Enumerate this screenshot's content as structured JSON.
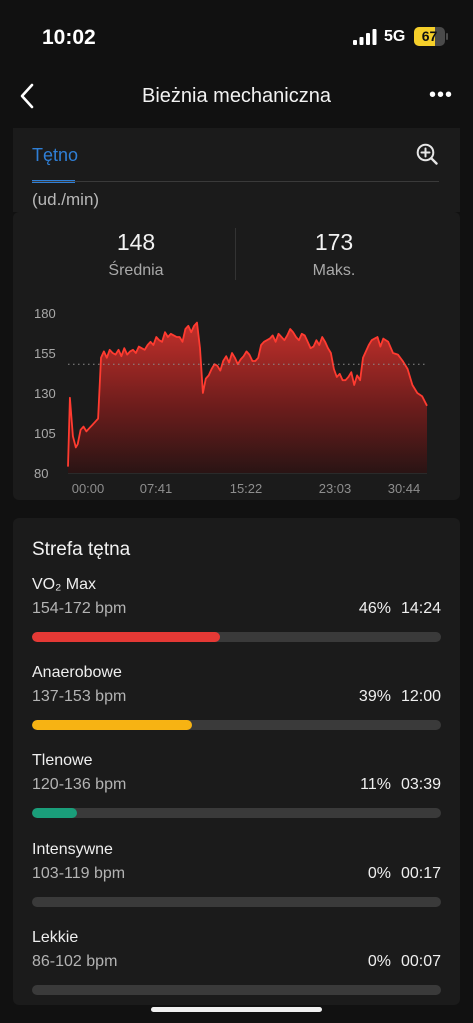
{
  "status_bar": {
    "time": "10:02",
    "network": "5G",
    "battery": "67",
    "battery_level": 0.67
  },
  "nav": {
    "title": "Bieżnia mechaniczna",
    "back_icon": "chevron-left-icon",
    "more_icon": "more-horizontal-icon",
    "more_label": "•••"
  },
  "tab": {
    "label": "Tętno",
    "zoom_icon": "zoom-in-icon",
    "unit": "(ud./min)"
  },
  "stats": {
    "average": {
      "value": "148",
      "label": "Średnia"
    },
    "max": {
      "value": "173",
      "label": "Maks."
    }
  },
  "chart_data": {
    "type": "area",
    "y_ticks": [
      "180",
      "155",
      "130",
      "105",
      "80"
    ],
    "x_ticks": [
      "00:00",
      "07:41",
      "15:22",
      "23:03",
      "30:44"
    ],
    "ylim": [
      80,
      180
    ],
    "reference_line": 148,
    "series": [
      {
        "x": [
          0,
          0.2,
          0.5,
          0.8,
          1.0,
          1.3,
          1.6,
          1.9,
          2.2,
          2.5,
          2.8,
          3.1,
          3.4,
          3.7,
          4.0,
          4.3,
          4.6,
          4.9,
          5.2,
          5.5,
          5.8,
          6.1,
          6.4,
          6.7,
          7.0,
          7.3,
          7.6,
          7.9,
          8.2,
          8.5,
          8.8,
          9.1,
          9.4,
          9.7,
          10.0,
          10.3,
          10.6,
          10.9,
          11.2,
          11.5,
          11.8,
          12.1,
          12.4,
          12.7,
          13.0,
          13.3,
          13.6,
          13.9,
          14.2,
          14.5,
          14.8,
          15.1,
          15.4,
          15.7,
          16.0,
          16.3,
          16.6,
          16.9,
          17.2,
          17.5,
          17.8,
          18.1,
          18.4,
          18.7,
          19.0,
          19.3,
          19.6,
          19.9,
          20.2,
          20.5,
          20.8,
          21.1,
          21.4,
          21.7,
          22.0,
          22.3,
          22.6,
          22.9,
          23.2,
          23.5,
          23.8,
          24.1,
          24.4,
          24.7,
          25.0,
          25.3,
          25.6,
          25.9,
          26.2,
          26.5,
          26.8,
          27.1,
          27.4,
          27.7,
          28.0,
          28.3,
          28.6,
          28.9,
          29.2,
          29.5,
          29.8,
          30.1,
          30.4,
          30.7,
          31.0,
          31.3,
          31.6,
          31.9,
          32.2,
          32.5,
          33.0,
          33.5,
          34.0,
          34.5,
          35.0,
          35.5,
          36.0,
          36.5,
          37.0
        ],
        "y": [
          84,
          127,
          103,
          96,
          98,
          107,
          109,
          106,
          108,
          110,
          112,
          114,
          152,
          156,
          152,
          157,
          155,
          154,
          157,
          153,
          158,
          154,
          156,
          157,
          155,
          159,
          158,
          157,
          160,
          162,
          160,
          165,
          163,
          162,
          168,
          165,
          167,
          166,
          165,
          165,
          162,
          170,
          172,
          168,
          172,
          174,
          158,
          130,
          139,
          141,
          145,
          148,
          147,
          144,
          150,
          153,
          149,
          155,
          152,
          148,
          151,
          153,
          156,
          154,
          150,
          150,
          152,
          160,
          162,
          163,
          164,
          166,
          162,
          167,
          165,
          163,
          166,
          170,
          168,
          165,
          163,
          167,
          166,
          162,
          158,
          159,
          163,
          160,
          165,
          162,
          158,
          155,
          145,
          140,
          142,
          138,
          138,
          140,
          143,
          135,
          141,
          138,
          152,
          156,
          160,
          163,
          164,
          165,
          159,
          164,
          162,
          155,
          154,
          150,
          145,
          135,
          130,
          128,
          122
        ]
      }
    ]
  },
  "zones": {
    "title": "Strefa tętna",
    "items": [
      {
        "name": "VO₂ Max",
        "range": "154-172 bpm",
        "percent": "46%",
        "time": "14:24",
        "fill": 0.46,
        "color": "#e53935"
      },
      {
        "name": "Anaerobowe",
        "range": "137-153 bpm",
        "percent": "39%",
        "time": "12:00",
        "fill": 0.39,
        "color": "#f7b313"
      },
      {
        "name": "Tlenowe",
        "range": "120-136 bpm",
        "percent": "11%",
        "time": "03:39",
        "fill": 0.11,
        "color": "#1a9e7a"
      },
      {
        "name": "Intensywne",
        "range": "103-119 bpm",
        "percent": "0%",
        "time": "00:17",
        "fill": 0,
        "color": "#3a86e0"
      },
      {
        "name": "Lekkie",
        "range": "86-102 bpm",
        "percent": "0%",
        "time": "00:07",
        "fill": 0,
        "color": "#9e9e9e"
      }
    ]
  }
}
